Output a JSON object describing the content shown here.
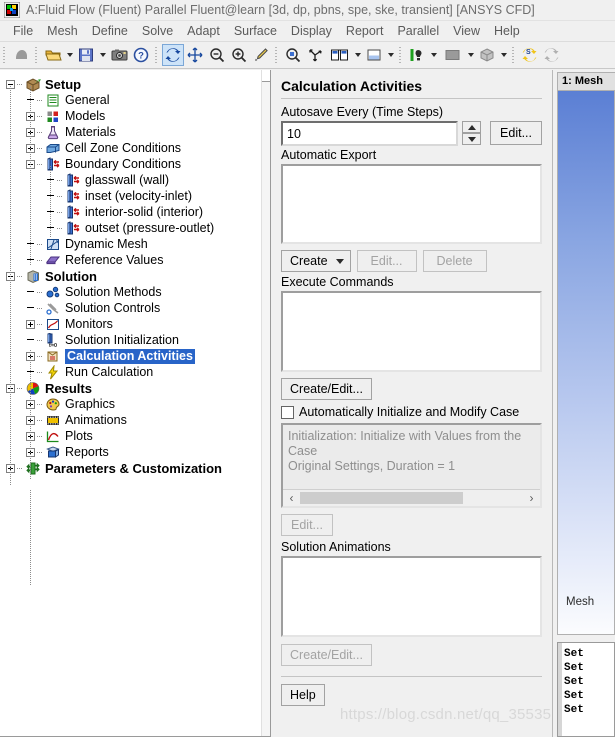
{
  "window": {
    "title": "A:Fluid Flow (Fluent) Parallel Fluent@learn  [3d, dp, pbns, spe, ske, transient] [ANSYS CFD]",
    "app_icon": "ansys-fluent-icon"
  },
  "menubar": {
    "items": [
      {
        "label": "File"
      },
      {
        "label": "Mesh"
      },
      {
        "label": "Define"
      },
      {
        "label": "Solve"
      },
      {
        "label": "Adapt"
      },
      {
        "label": "Surface"
      },
      {
        "label": "Display"
      },
      {
        "label": "Report"
      },
      {
        "label": "Parallel"
      },
      {
        "label": "View"
      },
      {
        "label": "Help"
      }
    ]
  },
  "toolbar": {
    "groups": [
      {
        "items": [
          {
            "icon": "cursor-select-icon",
            "type": "button",
            "active": false
          }
        ]
      },
      {
        "items": [
          {
            "icon": "open-folder-icon",
            "type": "button",
            "active": false
          },
          {
            "icon": "chevron-down-icon",
            "type": "dropdown-arrow"
          },
          {
            "icon": "save-floppy-icon",
            "type": "button",
            "active": false
          },
          {
            "icon": "chevron-down-icon",
            "type": "dropdown-arrow"
          },
          {
            "icon": "camera-icon",
            "type": "button",
            "active": false
          },
          {
            "icon": "help-question-icon",
            "type": "button",
            "active": false
          }
        ]
      },
      {
        "items": [
          {
            "icon": "rotate-refresh-icon",
            "type": "button",
            "active": true
          },
          {
            "icon": "pan-move-icon",
            "type": "button",
            "active": false
          },
          {
            "icon": "zoom-out-icon",
            "type": "button",
            "active": false
          },
          {
            "icon": "zoom-in-icon",
            "type": "button",
            "active": false
          },
          {
            "icon": "probe-eyedropper-icon",
            "type": "button",
            "active": false
          }
        ]
      },
      {
        "items": [
          {
            "icon": "zoom-region-icon",
            "type": "button",
            "active": false
          },
          {
            "icon": "axes-triad-icon",
            "type": "button",
            "active": false
          },
          {
            "icon": "view-layout-icon",
            "type": "button",
            "active": false
          },
          {
            "icon": "chevron-down-icon",
            "type": "dropdown-arrow"
          },
          {
            "icon": "background-color-icon",
            "type": "button",
            "active": false
          },
          {
            "icon": "chevron-down-icon",
            "type": "dropdown-arrow"
          }
        ]
      },
      {
        "items": [
          {
            "icon": "lighting-icon",
            "type": "button",
            "active": false
          },
          {
            "icon": "chevron-down-icon",
            "type": "dropdown-arrow"
          },
          {
            "icon": "color-swatch-icon",
            "type": "button",
            "active": false
          },
          {
            "icon": "chevron-down-icon",
            "type": "dropdown-arrow"
          },
          {
            "icon": "render-cube-icon",
            "type": "button",
            "active": false
          },
          {
            "icon": "chevron-down-icon",
            "type": "dropdown-arrow"
          }
        ]
      },
      {
        "items": [
          {
            "icon": "sync-s-icon",
            "type": "button",
            "active": false
          },
          {
            "icon": "refresh-gray-icon",
            "type": "button",
            "active": false
          }
        ]
      }
    ]
  },
  "tree": {
    "nodes": [
      {
        "id": "setup",
        "label": "Setup",
        "indent": 0,
        "expander": "minus",
        "icon": "setup-icon",
        "bold": true,
        "selected": false
      },
      {
        "id": "general",
        "label": "General",
        "indent": 1,
        "expander": "none",
        "icon": "general-icon",
        "bold": false,
        "selected": false
      },
      {
        "id": "models",
        "label": "Models",
        "indent": 1,
        "expander": "plus",
        "icon": "models-icon",
        "bold": false,
        "selected": false
      },
      {
        "id": "materials",
        "label": "Materials",
        "indent": 1,
        "expander": "plus",
        "icon": "materials-flask-icon",
        "bold": false,
        "selected": false
      },
      {
        "id": "cell-zone-conditions",
        "label": "Cell Zone Conditions",
        "indent": 1,
        "expander": "plus",
        "icon": "cell-zone-icon",
        "bold": false,
        "selected": false
      },
      {
        "id": "boundary-conditions",
        "label": "Boundary Conditions",
        "indent": 1,
        "expander": "minus",
        "icon": "boundary-icon",
        "bold": false,
        "selected": false
      },
      {
        "id": "glasswall",
        "label": "glasswall (wall)",
        "indent": 2,
        "expander": "none",
        "icon": "boundary-icon",
        "bold": false,
        "selected": false
      },
      {
        "id": "inset",
        "label": "inset (velocity-inlet)",
        "indent": 2,
        "expander": "none",
        "icon": "boundary-icon",
        "bold": false,
        "selected": false
      },
      {
        "id": "interior-solid",
        "label": "interior-solid (interior)",
        "indent": 2,
        "expander": "none",
        "icon": "boundary-icon",
        "bold": false,
        "selected": false
      },
      {
        "id": "outset",
        "label": "outset (pressure-outlet)",
        "indent": 2,
        "expander": "none",
        "icon": "boundary-icon",
        "bold": false,
        "selected": false
      },
      {
        "id": "dynamic-mesh",
        "label": "Dynamic Mesh",
        "indent": 1,
        "expander": "none",
        "icon": "dynamic-mesh-icon",
        "bold": false,
        "selected": false
      },
      {
        "id": "reference-values",
        "label": "Reference Values",
        "indent": 1,
        "expander": "none",
        "icon": "reference-values-icon",
        "bold": false,
        "selected": false
      },
      {
        "id": "solution",
        "label": "Solution",
        "indent": 0,
        "expander": "minus",
        "icon": "solution-icon",
        "bold": true,
        "selected": false
      },
      {
        "id": "solution-methods",
        "label": "Solution Methods",
        "indent": 1,
        "expander": "none",
        "icon": "solution-methods-icon",
        "bold": false,
        "selected": false
      },
      {
        "id": "solution-controls",
        "label": "Solution Controls",
        "indent": 1,
        "expander": "none",
        "icon": "solution-controls-icon",
        "bold": false,
        "selected": false
      },
      {
        "id": "monitors",
        "label": "Monitors",
        "indent": 1,
        "expander": "plus",
        "icon": "monitors-icon",
        "bold": false,
        "selected": false
      },
      {
        "id": "solution-initialization",
        "label": "Solution Initialization",
        "indent": 1,
        "expander": "none",
        "icon": "initialization-icon",
        "bold": false,
        "selected": false
      },
      {
        "id": "calculation-activities",
        "label": "Calculation Activities",
        "indent": 1,
        "expander": "plus",
        "icon": "calc-activities-icon",
        "bold": false,
        "selected": true
      },
      {
        "id": "run-calculation",
        "label": "Run Calculation",
        "indent": 1,
        "expander": "none",
        "icon": "run-calculation-icon",
        "bold": false,
        "selected": false
      },
      {
        "id": "results",
        "label": "Results",
        "indent": 0,
        "expander": "minus",
        "icon": "results-icon",
        "bold": true,
        "selected": false
      },
      {
        "id": "graphics",
        "label": "Graphics",
        "indent": 1,
        "expander": "plus",
        "icon": "graphics-palette-icon",
        "bold": false,
        "selected": false
      },
      {
        "id": "animations",
        "label": "Animations",
        "indent": 1,
        "expander": "plus",
        "icon": "animations-film-icon",
        "bold": false,
        "selected": false
      },
      {
        "id": "plots",
        "label": "Plots",
        "indent": 1,
        "expander": "plus",
        "icon": "plots-icon",
        "bold": false,
        "selected": false
      },
      {
        "id": "reports",
        "label": "Reports",
        "indent": 1,
        "expander": "plus",
        "icon": "reports-icon",
        "bold": false,
        "selected": false
      },
      {
        "id": "parameters-customization",
        "label": "Parameters & Customization",
        "indent": 0,
        "expander": "plus",
        "icon": "parameters-icon",
        "bold": true,
        "selected": false
      }
    ]
  },
  "task_page": {
    "title": "Calculation Activities",
    "autosave": {
      "label": "Autosave Every (Time Steps)",
      "value": "10",
      "spin_up": "increment",
      "spin_down": "decrement",
      "edit_label": "Edit..."
    },
    "automatic_export": {
      "label": "Automatic Export",
      "items": [],
      "create_label": "Create",
      "edit_label": "Edit...",
      "delete_label": "Delete"
    },
    "execute_commands": {
      "label": "Execute Commands",
      "items": [],
      "create_edit_label": "Create/Edit..."
    },
    "auto_init": {
      "checkbox_label": "Automatically Initialize and Modify Case",
      "checked": false,
      "summary_line1": "Initialization: Initialize with Values from the Case",
      "summary_line2": "Original Settings, Duration = 1",
      "scroll_left": "‹",
      "scroll_right": "›",
      "edit_label": "Edit..."
    },
    "solution_animations": {
      "label": "Solution Animations",
      "items": [],
      "create_edit_label": "Create/Edit..."
    },
    "help_label": "Help"
  },
  "graphics": {
    "tab_label": "1: Mesh",
    "viewport_label": "Mesh",
    "console_lines": [
      "Set",
      "Set",
      "Set",
      "Set",
      "Set"
    ]
  },
  "watermark": {
    "text": "https://blog.csdn.net/qq_35535"
  },
  "colors": {
    "selection_blue": "#2864c8",
    "panel_gray": "#f0f0f0",
    "toolbar_active": "#cde3f8",
    "viewport_top": "#5b7fd4"
  }
}
